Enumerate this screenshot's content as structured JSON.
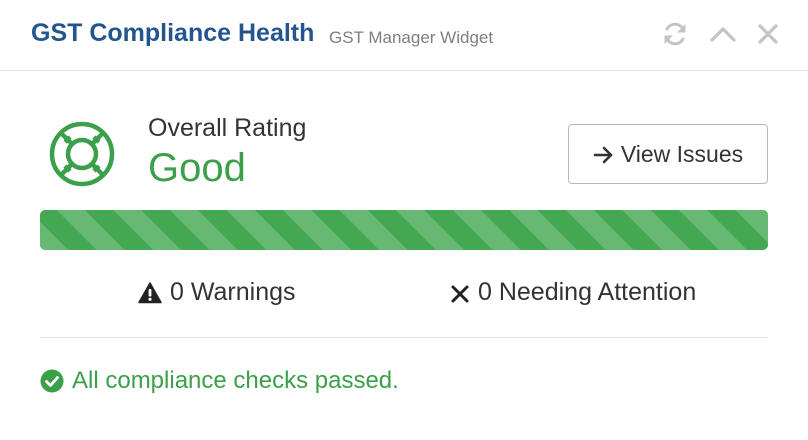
{
  "header": {
    "title": "GST Compliance Health",
    "subtitle": "GST Manager Widget",
    "icons": [
      "refresh-icon",
      "chevron-up-icon",
      "close-icon"
    ]
  },
  "rating": {
    "icon": "life-ring-icon",
    "label": "Overall Rating",
    "value": "Good",
    "color": "#3c9f4a"
  },
  "actions": {
    "view_issues_label": "View Issues",
    "view_issues_icon": "arrow-right-icon"
  },
  "progress": {
    "percent": 100,
    "color": "#44a853"
  },
  "stats": {
    "warnings": {
      "icon": "warning-icon",
      "label": "0 Warnings"
    },
    "attention": {
      "icon": "times-icon",
      "label": "0 Needing Attention"
    }
  },
  "status": {
    "icon": "check-circle-icon",
    "message": "All compliance checks passed.",
    "color": "#3c9f4a"
  },
  "colors": {
    "title": "#24558e",
    "subtitle": "#7f7f7f",
    "header_icons": "#c4c4c4"
  }
}
